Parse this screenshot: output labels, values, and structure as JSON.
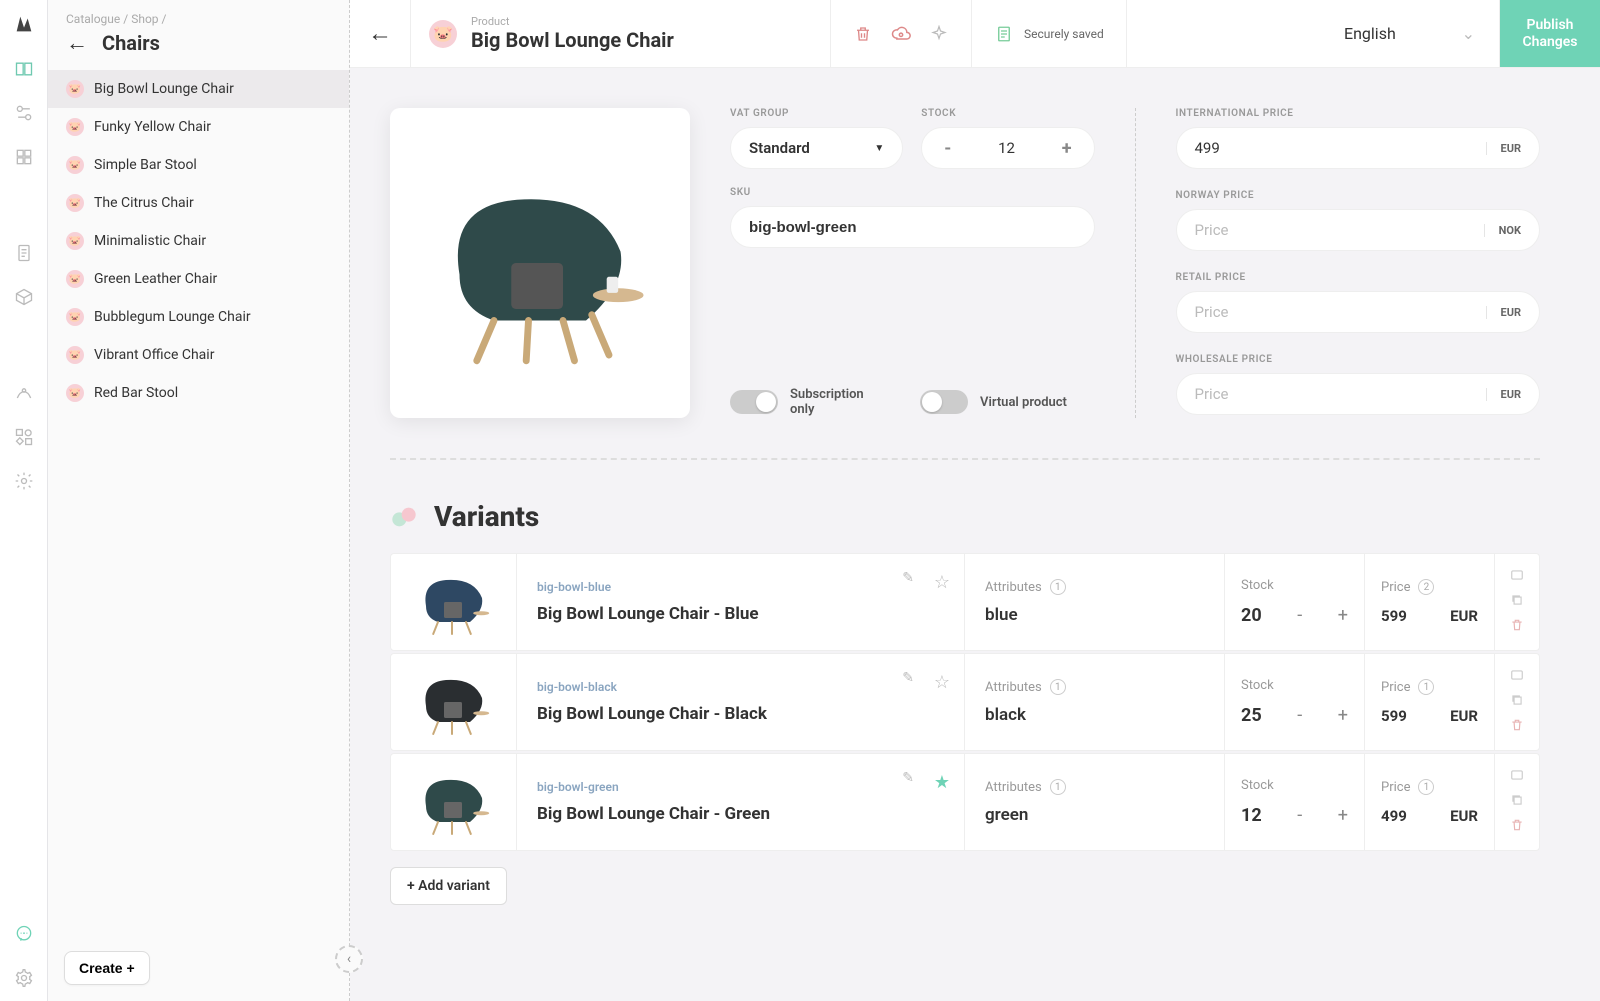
{
  "breadcrumb": {
    "catalogue": "Catalogue",
    "sep": "/",
    "shop": "Shop"
  },
  "leftpanel": {
    "title": "Chairs",
    "items": [
      {
        "label": "Big Bowl Lounge Chair"
      },
      {
        "label": "Funky Yellow Chair"
      },
      {
        "label": "Simple Bar Stool"
      },
      {
        "label": "The Citrus Chair"
      },
      {
        "label": "Minimalistic Chair"
      },
      {
        "label": "Green Leather Chair"
      },
      {
        "label": "Bubblegum Lounge Chair"
      },
      {
        "label": "Vibrant Office Chair"
      },
      {
        "label": "Red Bar Stool"
      }
    ],
    "create": "Create +"
  },
  "header": {
    "product_label": "Product",
    "product_title": "Big Bowl Lounge Chair",
    "saved": "Securely saved",
    "language": "English",
    "publish": "Publish\nChanges"
  },
  "fields": {
    "vat_group": {
      "label": "VAT GROUP",
      "value": "Standard"
    },
    "stock": {
      "label": "STOCK",
      "value": "12"
    },
    "sku": {
      "label": "SKU",
      "value": "big-bowl-green"
    },
    "sub_only": "Subscription only",
    "virtual": "Virtual product",
    "price_placeholder": "Price",
    "prices": [
      {
        "label": "INTERNATIONAL PRICE",
        "value": "499",
        "currency": "EUR"
      },
      {
        "label": "NORWAY PRICE",
        "value": "",
        "currency": "NOK"
      },
      {
        "label": "RETAIL PRICE",
        "value": "",
        "currency": "EUR"
      },
      {
        "label": "WHOLESALE PRICE",
        "value": "",
        "currency": "EUR"
      }
    ]
  },
  "variants": {
    "title": "Variants",
    "attrs_label": "Attributes",
    "stock_label": "Stock",
    "price_label": "Price",
    "add": "+ Add variant",
    "rows": [
      {
        "sku": "big-bowl-blue",
        "name": "Big Bowl Lounge Chair - Blue",
        "attr": "blue",
        "stock": "20",
        "price": "599",
        "currency": "EUR",
        "attr_count": "1",
        "price_count": "2",
        "starred": false,
        "color": "#2e4863"
      },
      {
        "sku": "big-bowl-black",
        "name": "Big Bowl Lounge Chair - Black",
        "attr": "black",
        "stock": "25",
        "price": "599",
        "currency": "EUR",
        "attr_count": "1",
        "price_count": "1",
        "starred": false,
        "color": "#2a2e31"
      },
      {
        "sku": "big-bowl-green",
        "name": "Big Bowl Lounge Chair - Green",
        "attr": "green",
        "stock": "12",
        "price": "499",
        "currency": "EUR",
        "attr_count": "1",
        "price_count": "1",
        "starred": true,
        "color": "#2f4a4a"
      }
    ]
  }
}
